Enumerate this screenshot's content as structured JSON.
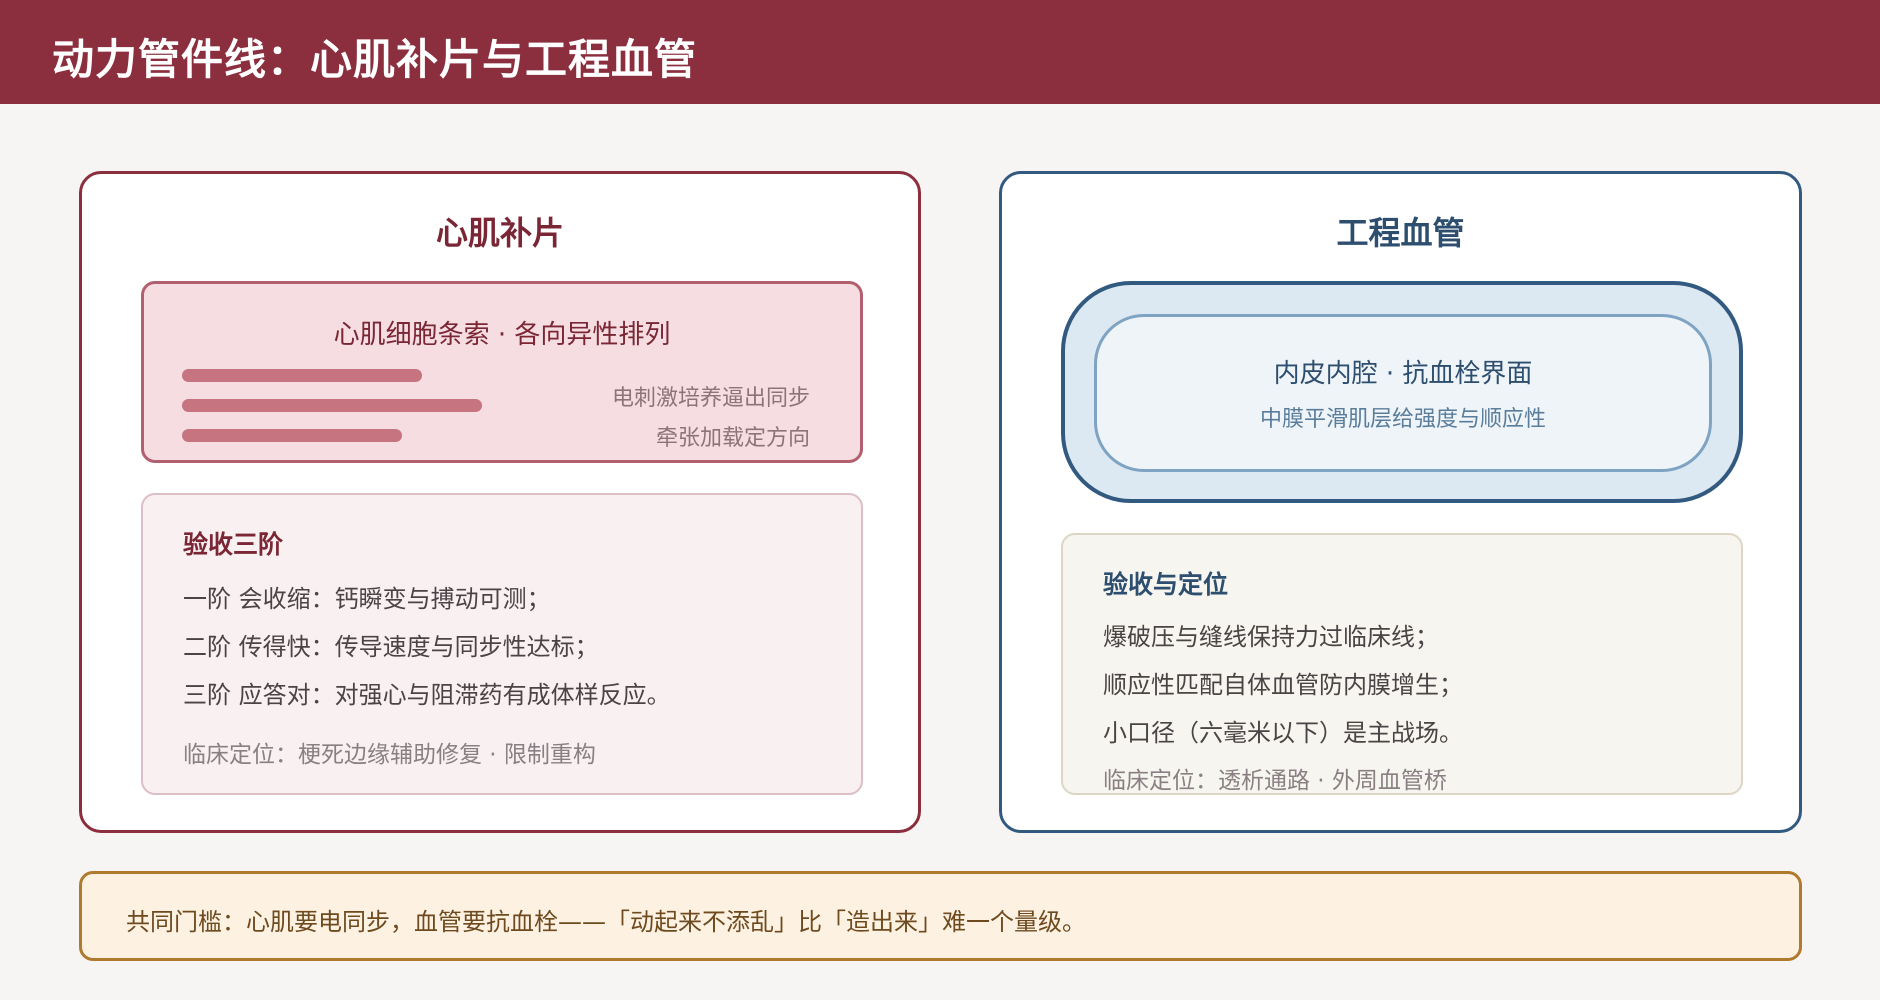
{
  "header": {
    "title": "动力管件线：心肌补片与工程血管"
  },
  "colors": {
    "header_bg": "#8b2e3d",
    "cardiac_accent": "#8b2e3d",
    "vessel_accent": "#325a80",
    "footer_accent": "#b07a2e"
  },
  "cardiac": {
    "title": "心肌补片",
    "fiber": {
      "title": "心肌细胞条索 · 各向异性排列",
      "notes": [
        "电刺激培养逼出同步",
        "牵张加载定方向"
      ]
    },
    "acceptance": {
      "heading": "验收三阶",
      "lines": [
        "一阶 会收缩：钙瞬变与搏动可测；",
        "二阶 传得快：传导速度与同步性达标；",
        "三阶 应答对：对强心与阻滞药有成体样反应。"
      ],
      "note": "临床定位：梗死边缘辅助修复 · 限制重构"
    }
  },
  "vessel": {
    "title": "工程血管",
    "rings": {
      "title": "内皮内腔 · 抗血栓界面",
      "subtitle": "中膜平滑肌层给强度与顺应性"
    },
    "acceptance": {
      "heading": "验收与定位",
      "lines": [
        "爆破压与缝线保持力过临床线；",
        "顺应性匹配自体血管防内膜增生；",
        "小口径（六毫米以下）是主战场。"
      ],
      "note": "临床定位：透析通路 · 外周血管桥"
    }
  },
  "footer": {
    "text": "共同门槛：心肌要电同步，血管要抗血栓——「动起来不添乱」比「造出来」难一个量级。"
  }
}
